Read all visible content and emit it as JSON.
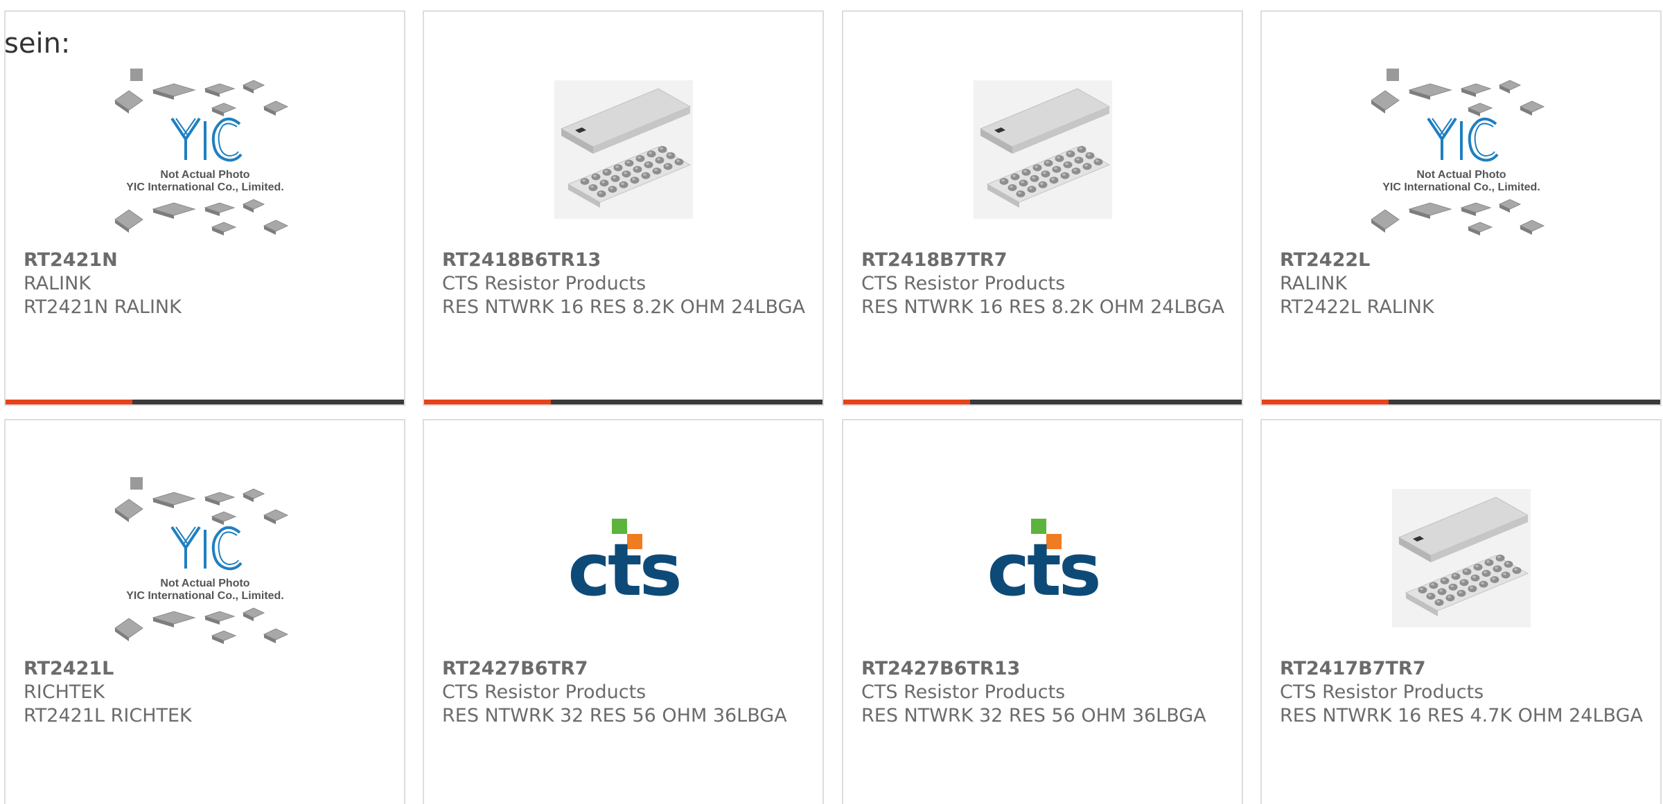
{
  "intro_text": "sein:",
  "colors": {
    "accent": "#e8421a",
    "bar_dark": "#3a3a3a",
    "card_border": "#dddddd",
    "text": "#6b6b6b",
    "cts_blue": "#0e4a78",
    "cts_green": "#5cb33d",
    "cts_orange": "#f07c22",
    "yic_blue": "#1f7fc0"
  },
  "placeholder_image": {
    "line1": "Not Actual Photo",
    "line2": "YIC International Co., Limited."
  },
  "cts_logo_text": "cts",
  "products": [
    {
      "part": "RT2421N",
      "manufacturer": "RALINK",
      "description": "RT2421N RALINK",
      "image": "yic-placeholder",
      "bar": true
    },
    {
      "part": "RT2418B6TR13",
      "manufacturer": "CTS Resistor Products",
      "description": "RES NTWRK 16 RES 8.2K OHM 24LBGA",
      "image": "bga-package",
      "bar": true
    },
    {
      "part": "RT2418B7TR7",
      "manufacturer": "CTS Resistor Products",
      "description": "RES NTWRK 16 RES 8.2K OHM 24LBGA",
      "image": "bga-package",
      "bar": true
    },
    {
      "part": "RT2422L",
      "manufacturer": "RALINK",
      "description": "RT2422L RALINK",
      "image": "yic-placeholder",
      "bar": true
    },
    {
      "part": "RT2421L",
      "manufacturer": "RICHTEK",
      "description": "RT2421L RICHTEK",
      "image": "yic-placeholder",
      "bar": false
    },
    {
      "part": "RT2427B6TR7",
      "manufacturer": "CTS Resistor Products",
      "description": "RES NTWRK 32 RES 56 OHM 36LBGA",
      "image": "cts-logo",
      "bar": false
    },
    {
      "part": "RT2427B6TR13",
      "manufacturer": "CTS Resistor Products",
      "description": "RES NTWRK 32 RES 56 OHM 36LBGA",
      "image": "cts-logo",
      "bar": false
    },
    {
      "part": "RT2417B7TR7",
      "manufacturer": "CTS Resistor Products",
      "description": "RES NTWRK 16 RES 4.7K OHM 24LBGA",
      "image": "bga-package",
      "bar": false
    }
  ]
}
